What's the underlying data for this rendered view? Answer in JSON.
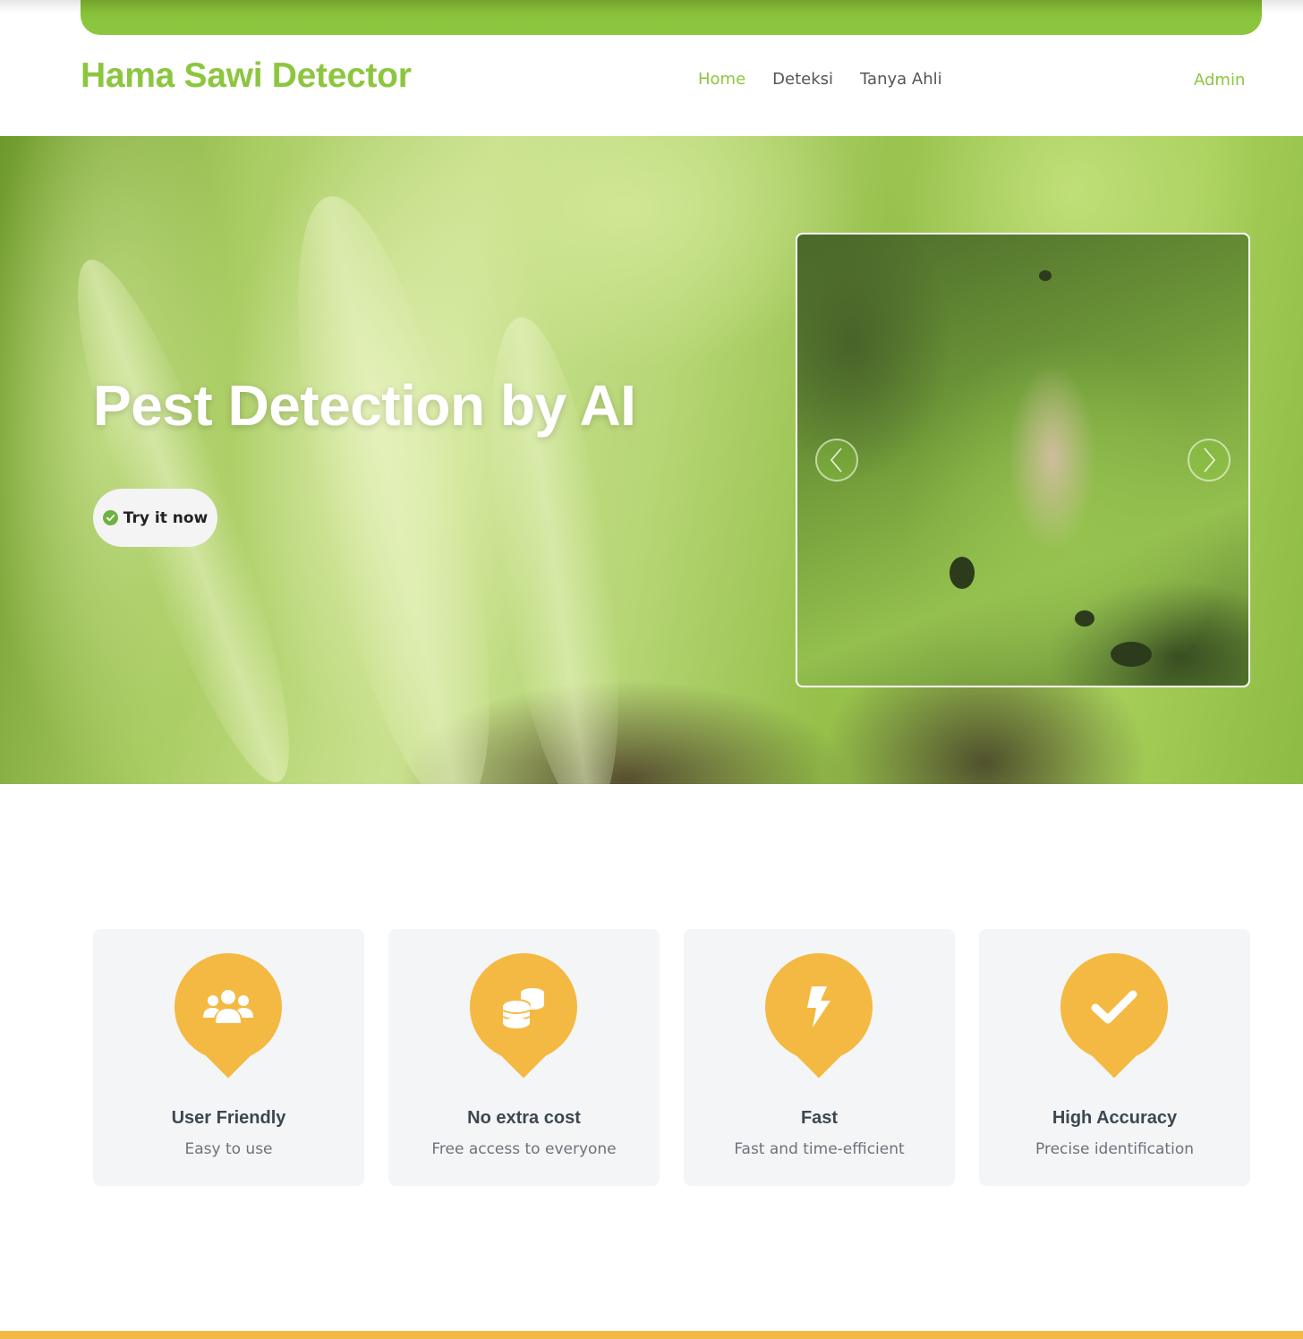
{
  "brand": {
    "name": "Hama Sawi Detector"
  },
  "nav": {
    "items": [
      {
        "label": "Home",
        "active": true
      },
      {
        "label": "Deteksi",
        "active": false
      },
      {
        "label": "Tanya Ahli",
        "active": false
      }
    ],
    "admin_label": "Admin"
  },
  "hero": {
    "title": "Pest Detection by AI",
    "cta_label": "Try it now",
    "carousel": {
      "prev_icon": "chevron-left-icon",
      "next_icon": "chevron-right-icon"
    }
  },
  "features": [
    {
      "title": "User Friendly",
      "desc": "Easy to use",
      "icon": "users-icon"
    },
    {
      "title": "No extra cost",
      "desc": "Free access to everyone",
      "icon": "coins-icon"
    },
    {
      "title": "Fast",
      "desc": "Fast and time-efficient",
      "icon": "bolt-icon"
    },
    {
      "title": "High Accuracy",
      "desc": "Precise identification",
      "icon": "check-icon"
    }
  ],
  "colors": {
    "primary_green": "#8cc63f",
    "accent_orange": "#f4b942",
    "card_bg": "#f4f5f7"
  }
}
